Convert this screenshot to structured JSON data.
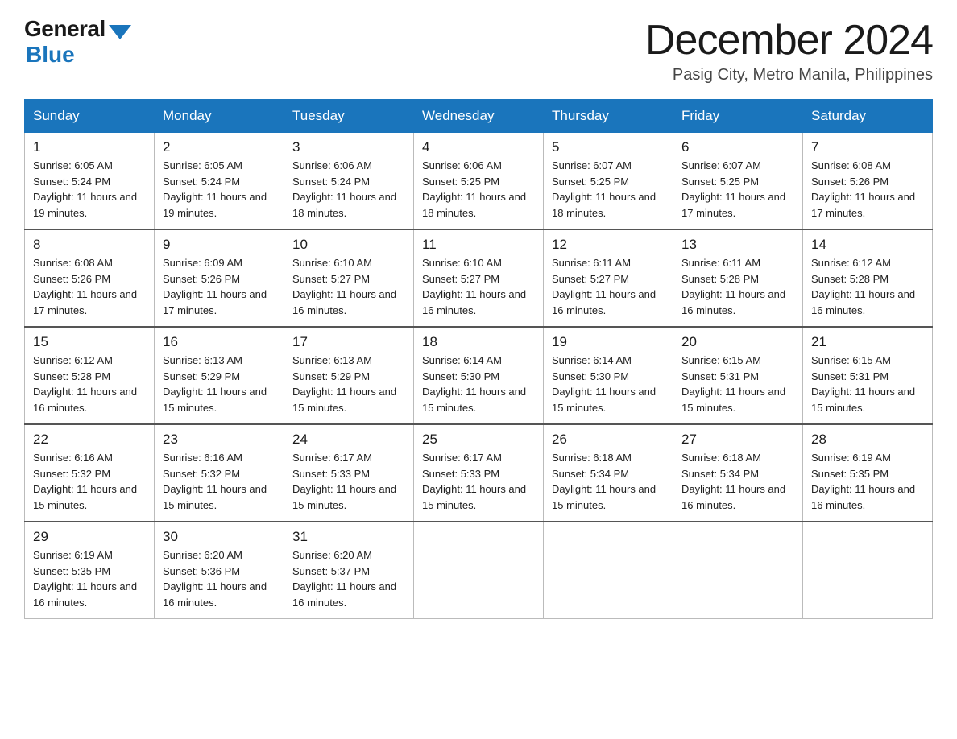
{
  "logo": {
    "general": "General",
    "blue": "Blue"
  },
  "header": {
    "month": "December 2024",
    "location": "Pasig City, Metro Manila, Philippines"
  },
  "weekdays": [
    "Sunday",
    "Monday",
    "Tuesday",
    "Wednesday",
    "Thursday",
    "Friday",
    "Saturday"
  ],
  "weeks": [
    [
      {
        "day": "1",
        "sunrise": "6:05 AM",
        "sunset": "5:24 PM",
        "daylight": "11 hours and 19 minutes."
      },
      {
        "day": "2",
        "sunrise": "6:05 AM",
        "sunset": "5:24 PM",
        "daylight": "11 hours and 19 minutes."
      },
      {
        "day": "3",
        "sunrise": "6:06 AM",
        "sunset": "5:24 PM",
        "daylight": "11 hours and 18 minutes."
      },
      {
        "day": "4",
        "sunrise": "6:06 AM",
        "sunset": "5:25 PM",
        "daylight": "11 hours and 18 minutes."
      },
      {
        "day": "5",
        "sunrise": "6:07 AM",
        "sunset": "5:25 PM",
        "daylight": "11 hours and 18 minutes."
      },
      {
        "day": "6",
        "sunrise": "6:07 AM",
        "sunset": "5:25 PM",
        "daylight": "11 hours and 17 minutes."
      },
      {
        "day": "7",
        "sunrise": "6:08 AM",
        "sunset": "5:26 PM",
        "daylight": "11 hours and 17 minutes."
      }
    ],
    [
      {
        "day": "8",
        "sunrise": "6:08 AM",
        "sunset": "5:26 PM",
        "daylight": "11 hours and 17 minutes."
      },
      {
        "day": "9",
        "sunrise": "6:09 AM",
        "sunset": "5:26 PM",
        "daylight": "11 hours and 17 minutes."
      },
      {
        "day": "10",
        "sunrise": "6:10 AM",
        "sunset": "5:27 PM",
        "daylight": "11 hours and 16 minutes."
      },
      {
        "day": "11",
        "sunrise": "6:10 AM",
        "sunset": "5:27 PM",
        "daylight": "11 hours and 16 minutes."
      },
      {
        "day": "12",
        "sunrise": "6:11 AM",
        "sunset": "5:27 PM",
        "daylight": "11 hours and 16 minutes."
      },
      {
        "day": "13",
        "sunrise": "6:11 AM",
        "sunset": "5:28 PM",
        "daylight": "11 hours and 16 minutes."
      },
      {
        "day": "14",
        "sunrise": "6:12 AM",
        "sunset": "5:28 PM",
        "daylight": "11 hours and 16 minutes."
      }
    ],
    [
      {
        "day": "15",
        "sunrise": "6:12 AM",
        "sunset": "5:28 PM",
        "daylight": "11 hours and 16 minutes."
      },
      {
        "day": "16",
        "sunrise": "6:13 AM",
        "sunset": "5:29 PM",
        "daylight": "11 hours and 15 minutes."
      },
      {
        "day": "17",
        "sunrise": "6:13 AM",
        "sunset": "5:29 PM",
        "daylight": "11 hours and 15 minutes."
      },
      {
        "day": "18",
        "sunrise": "6:14 AM",
        "sunset": "5:30 PM",
        "daylight": "11 hours and 15 minutes."
      },
      {
        "day": "19",
        "sunrise": "6:14 AM",
        "sunset": "5:30 PM",
        "daylight": "11 hours and 15 minutes."
      },
      {
        "day": "20",
        "sunrise": "6:15 AM",
        "sunset": "5:31 PM",
        "daylight": "11 hours and 15 minutes."
      },
      {
        "day": "21",
        "sunrise": "6:15 AM",
        "sunset": "5:31 PM",
        "daylight": "11 hours and 15 minutes."
      }
    ],
    [
      {
        "day": "22",
        "sunrise": "6:16 AM",
        "sunset": "5:32 PM",
        "daylight": "11 hours and 15 minutes."
      },
      {
        "day": "23",
        "sunrise": "6:16 AM",
        "sunset": "5:32 PM",
        "daylight": "11 hours and 15 minutes."
      },
      {
        "day": "24",
        "sunrise": "6:17 AM",
        "sunset": "5:33 PM",
        "daylight": "11 hours and 15 minutes."
      },
      {
        "day": "25",
        "sunrise": "6:17 AM",
        "sunset": "5:33 PM",
        "daylight": "11 hours and 15 minutes."
      },
      {
        "day": "26",
        "sunrise": "6:18 AM",
        "sunset": "5:34 PM",
        "daylight": "11 hours and 15 minutes."
      },
      {
        "day": "27",
        "sunrise": "6:18 AM",
        "sunset": "5:34 PM",
        "daylight": "11 hours and 16 minutes."
      },
      {
        "day": "28",
        "sunrise": "6:19 AM",
        "sunset": "5:35 PM",
        "daylight": "11 hours and 16 minutes."
      }
    ],
    [
      {
        "day": "29",
        "sunrise": "6:19 AM",
        "sunset": "5:35 PM",
        "daylight": "11 hours and 16 minutes."
      },
      {
        "day": "30",
        "sunrise": "6:20 AM",
        "sunset": "5:36 PM",
        "daylight": "11 hours and 16 minutes."
      },
      {
        "day": "31",
        "sunrise": "6:20 AM",
        "sunset": "5:37 PM",
        "daylight": "11 hours and 16 minutes."
      },
      null,
      null,
      null,
      null
    ]
  ]
}
